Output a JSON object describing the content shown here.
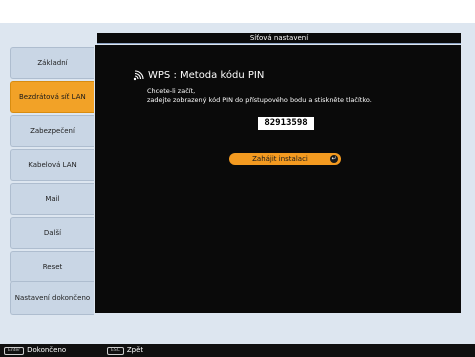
{
  "window": {
    "title": "Síťová nastavení"
  },
  "sidebar": {
    "items": [
      {
        "label": "Základní",
        "active": false
      },
      {
        "label": "Bezdrátová síť LAN",
        "active": true
      },
      {
        "label": "Zabezpečení",
        "active": false
      },
      {
        "label": "Kabelová LAN",
        "active": false
      },
      {
        "label": "Mail",
        "active": false
      },
      {
        "label": "Další",
        "active": false
      },
      {
        "label": "Reset",
        "active": false
      },
      {
        "label": "Nastavení dokončeno",
        "active": false
      }
    ]
  },
  "main": {
    "heading": "WPS : Metoda kódu PIN",
    "instruction_line1": "Chcete-li začít,",
    "instruction_line2": "zadejte zobrazený kód PIN do přístupového bodu a stiskněte tlačítko.",
    "pin_code": "82913598",
    "start_button_label": "Zahájit instalaci",
    "icons": {
      "wps": "wifi-signal-icon",
      "enter": "enter-arrow-icon"
    }
  },
  "footer": {
    "enter_key": "Enter",
    "enter_label": "Dokončeno",
    "esc_key": "ESC",
    "esc_label": "Zpět"
  },
  "colors": {
    "accent": "#f39a20",
    "panel": "#0a0a0a",
    "sidebar_item": "#c9d6e5",
    "background": "#dde6f0"
  }
}
